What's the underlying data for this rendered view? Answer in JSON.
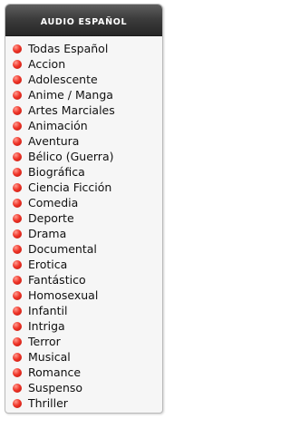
{
  "panel": {
    "title": "AUDIO ESPAÑOL",
    "bullet_color": "#e8281c",
    "items": [
      {
        "label": "Todas Español"
      },
      {
        "label": "Accion"
      },
      {
        "label": "Adolescente"
      },
      {
        "label": "Anime / Manga"
      },
      {
        "label": "Artes Marciales"
      },
      {
        "label": "Animación"
      },
      {
        "label": "Aventura"
      },
      {
        "label": "Bélico (Guerra)"
      },
      {
        "label": "Biográfica"
      },
      {
        "label": "Ciencia Ficción"
      },
      {
        "label": "Comedia"
      },
      {
        "label": "Deporte"
      },
      {
        "label": "Drama"
      },
      {
        "label": "Documental"
      },
      {
        "label": "Erotica"
      },
      {
        "label": "Fantástico"
      },
      {
        "label": "Homosexual"
      },
      {
        "label": "Infantil"
      },
      {
        "label": "Intriga"
      },
      {
        "label": "Terror"
      },
      {
        "label": "Musical"
      },
      {
        "label": "Romance"
      },
      {
        "label": "Suspenso"
      },
      {
        "label": "Thriller"
      }
    ]
  }
}
